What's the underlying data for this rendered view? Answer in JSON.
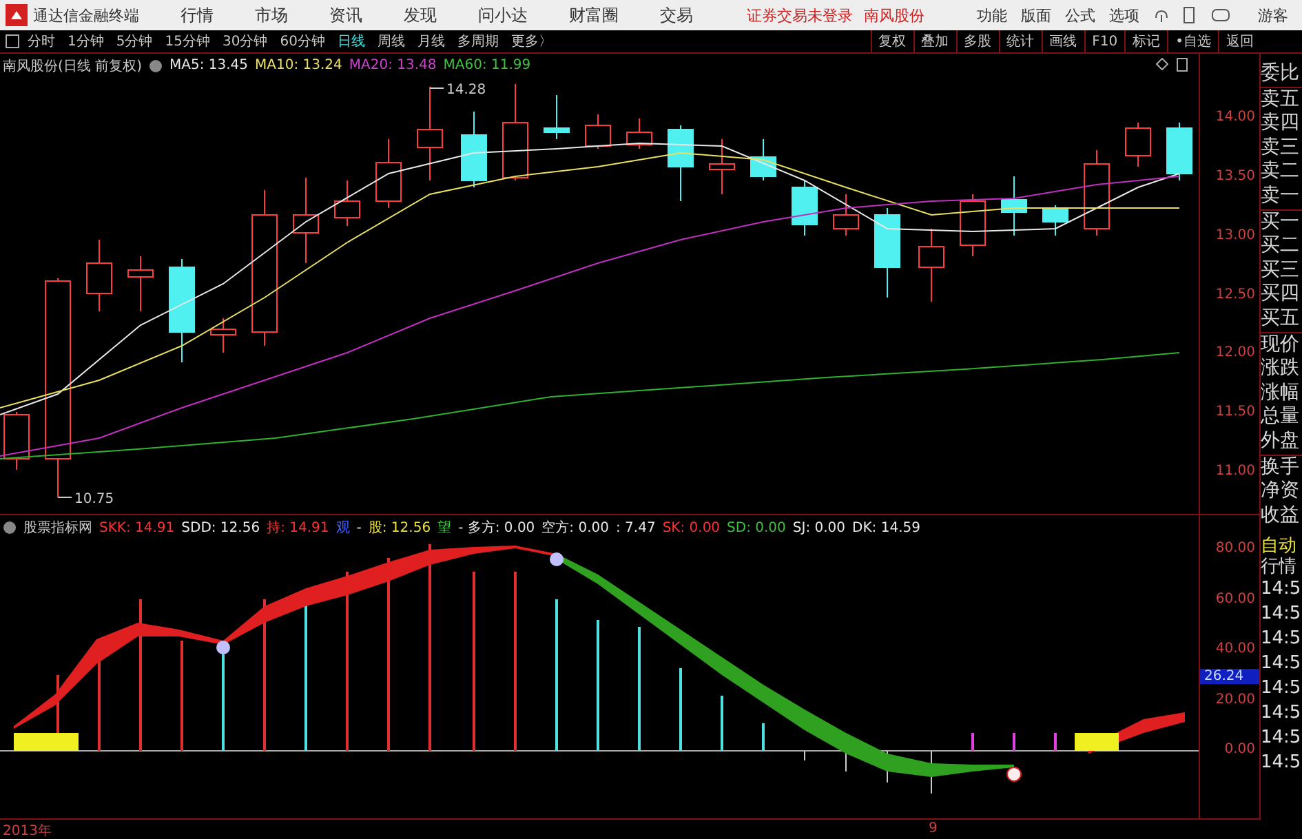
{
  "app": {
    "title": "通达信金融终端",
    "menus": [
      "行情",
      "市场",
      "资讯",
      "发现",
      "问小达",
      "财富圈",
      "交易"
    ],
    "status": [
      "证券交易未登录",
      "南风股份"
    ],
    "right_menus": [
      "功能",
      "版面",
      "公式",
      "选项"
    ],
    "user": "游客"
  },
  "toolbar": {
    "periods": [
      {
        "label": "分时",
        "selected": false
      },
      {
        "label": "1分钟",
        "selected": false
      },
      {
        "label": "5分钟",
        "selected": false
      },
      {
        "label": "15分钟",
        "selected": false
      },
      {
        "label": "30分钟",
        "selected": false
      },
      {
        "label": "60分钟",
        "selected": false
      },
      {
        "label": "日线",
        "selected": true
      },
      {
        "label": "周线",
        "selected": false
      },
      {
        "label": "月线",
        "selected": false
      },
      {
        "label": "多周期",
        "selected": false
      },
      {
        "label": "更多〉",
        "selected": false
      }
    ],
    "buttons": [
      "复权",
      "叠加",
      "多股",
      "统计",
      "画线",
      "F10",
      "标记",
      "•自选",
      "返回"
    ]
  },
  "main_chart": {
    "title": "南风股份(日线 前复权)",
    "legend": [
      {
        "text": "MA5: 13.45",
        "color": "#e8e8e8"
      },
      {
        "text": "MA10: 13.24",
        "color": "#e8e060"
      },
      {
        "text": "MA20: 13.48",
        "color": "#d040d0"
      },
      {
        "text": "MA60: 11.99",
        "color": "#40c040"
      }
    ],
    "high_label": "14.28",
    "low_label": "10.75",
    "y_axis": [
      "14.00",
      "13.50",
      "13.00",
      "12.50",
      "12.00",
      "11.50",
      "11.00"
    ]
  },
  "indicator": {
    "title": "股票指标网",
    "legend": [
      {
        "text": "SKK: 14.91",
        "color": "#ff3030"
      },
      {
        "text": "SDD: 12.56",
        "color": "#e8e8e8"
      },
      {
        "text": "持: 14.91",
        "color": "#ff3030"
      },
      {
        "text": "观",
        "color": "#4060ff"
      },
      {
        "text": "-",
        "color": "#e8e8e8"
      },
      {
        "text": "股: 12.56",
        "color": "#e8e040"
      },
      {
        "text": "望",
        "color": "#40c040"
      },
      {
        "text": "- 多方: 0.00",
        "color": "#e8e8e8"
      },
      {
        "text": "空方: 0.00",
        "color": "#e8e8e8"
      },
      {
        "text": ": 7.47",
        "color": "#e8e8e8"
      },
      {
        "text": "SK: 0.00",
        "color": "#ff3030"
      },
      {
        "text": "SD: 0.00",
        "color": "#40c040"
      },
      {
        "text": "SJ: 0.00",
        "color": "#e8e8e8"
      },
      {
        "text": "DK: 14.59",
        "color": "#e8e8e8"
      }
    ],
    "y_axis": [
      "80.00",
      "60.00",
      "40.00",
      "20.00",
      "0.00"
    ],
    "current_value": "26.24"
  },
  "time_axis": [
    "2013年",
    "9"
  ],
  "side_panel": {
    "quote_labels": [
      "委比",
      "卖五",
      "卖四",
      "卖三",
      "卖二",
      "卖一",
      "买一",
      "买二",
      "买三",
      "买四",
      "买五",
      "现价",
      "涨跌",
      "涨幅",
      "总量",
      "外盘",
      "换手",
      "净资",
      "收益"
    ],
    "auto_label": [
      "自动",
      "行情"
    ],
    "times": [
      "14:5",
      "14:5",
      "14:5",
      "14:5",
      "14:5",
      "14:5",
      "14:5",
      "14:5"
    ]
  }
}
